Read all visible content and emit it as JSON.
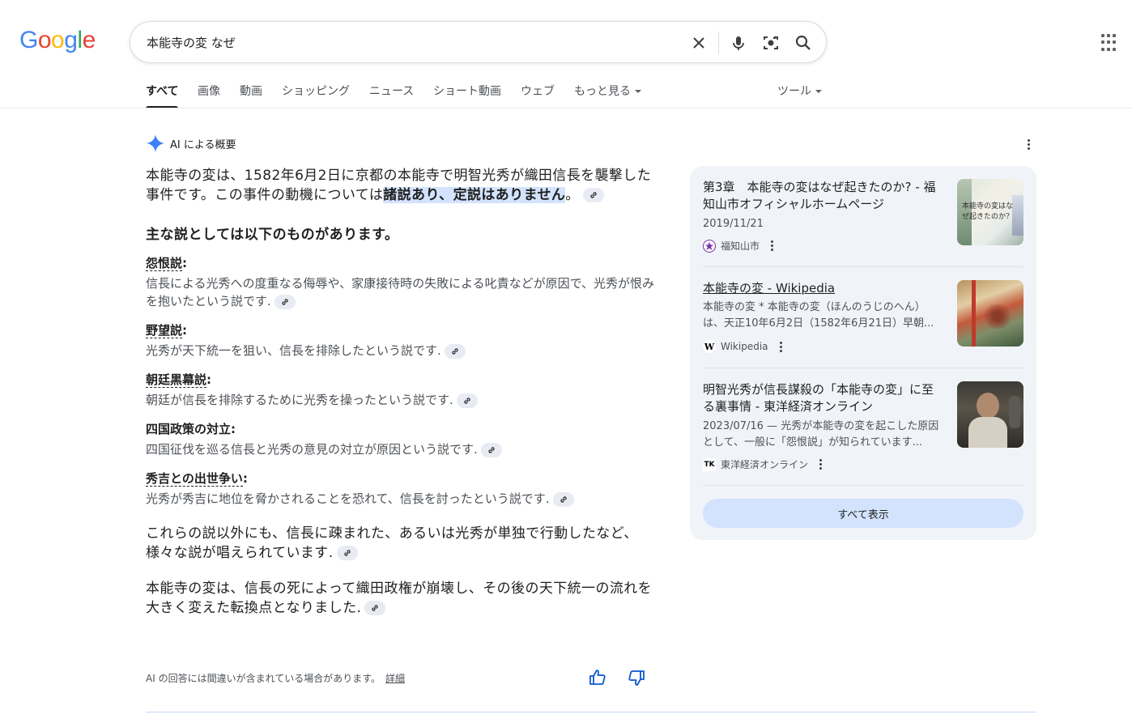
{
  "header": {
    "logo": [
      "G",
      "o",
      "o",
      "g",
      "l",
      "e"
    ],
    "logo_colors": [
      "#4285F4",
      "#EA4335",
      "#FBBC05",
      "#4285F4",
      "#34A853",
      "#EA4335"
    ],
    "query": "本能寺の変 なぜ"
  },
  "tabs": [
    {
      "label": "すべて",
      "active": true
    },
    {
      "label": "画像"
    },
    {
      "label": "動画"
    },
    {
      "label": "ショッピング"
    },
    {
      "label": "ニュース"
    },
    {
      "label": "ショート動画"
    },
    {
      "label": "ウェブ"
    },
    {
      "label": "もっと見る"
    },
    {
      "label": "ツール"
    }
  ],
  "ai": {
    "title": "AI による概要",
    "intro_a": "本能寺の変は、1582年6月2日に京都の本能寺で明智光秀が織田信長を襲撃した事件です。この事件の動機については",
    "intro_hl": "諸説あり、定説はありません",
    "intro_end": "。",
    "heading": "主な説としては以下のものがあります。",
    "theories": [
      {
        "term": "怨恨説",
        "desc": "信長による光秀への度重なる侮辱や、家康接待時の失敗による叱責などが原因で、光秀が恨みを抱いたという説です."
      },
      {
        "term": "野望説",
        "desc": "光秀が天下統一を狙い、信長を排除したという説です."
      },
      {
        "term": "朝廷黒幕説",
        "desc": "朝廷が信長を排除するために光秀を操ったという説です."
      },
      {
        "term": "四国政策の対立",
        "desc": "四国征伐を巡る信長と光秀の意見の対立が原因という説です."
      },
      {
        "term": "秀吉との出世争い",
        "desc": "光秀が秀吉に地位を脅かされることを恐れて、信長を討ったという説です."
      }
    ],
    "para2": "これらの説以外にも、信長に疎まれた、あるいは光秀が単独で行動したなど、様々な説が唱えられています.",
    "para3": "本能寺の変は、信長の死によって織田政権が崩壊し、その後の天下統一の流れを大きく変えた転換点となりました.",
    "disclaimer": "AI の回答には間違いが含まれている場合があります。",
    "details": "詳細"
  },
  "sources": [
    {
      "title": "第3章　本能寺の変はなぜ起きたのか? - 福知山市オフィシャルホームページ",
      "date": "2019/11/21",
      "site": "福知山市",
      "image_text": "本能寺の変はなぜ起きたのか?"
    },
    {
      "title": "本能寺の変 - Wikipedia",
      "desc": "本能寺の変 * 本能寺の変（ほんのうじのへん）は、天正10年6月2日（1582年6月21日）早朝...",
      "site": "Wikipedia",
      "favicon": "W"
    },
    {
      "title": "明智光秀が信長謀殺の「本能寺の変」に至る裏事情 - 東洋経済オンライン",
      "desc": "2023/07/16 — 光秀が本能寺の変を起こした原因として、一般に「怨恨説」が知られています...",
      "site": "東洋経済オンライン",
      "favicon": "TK"
    }
  ],
  "show_all": "すべて表示"
}
